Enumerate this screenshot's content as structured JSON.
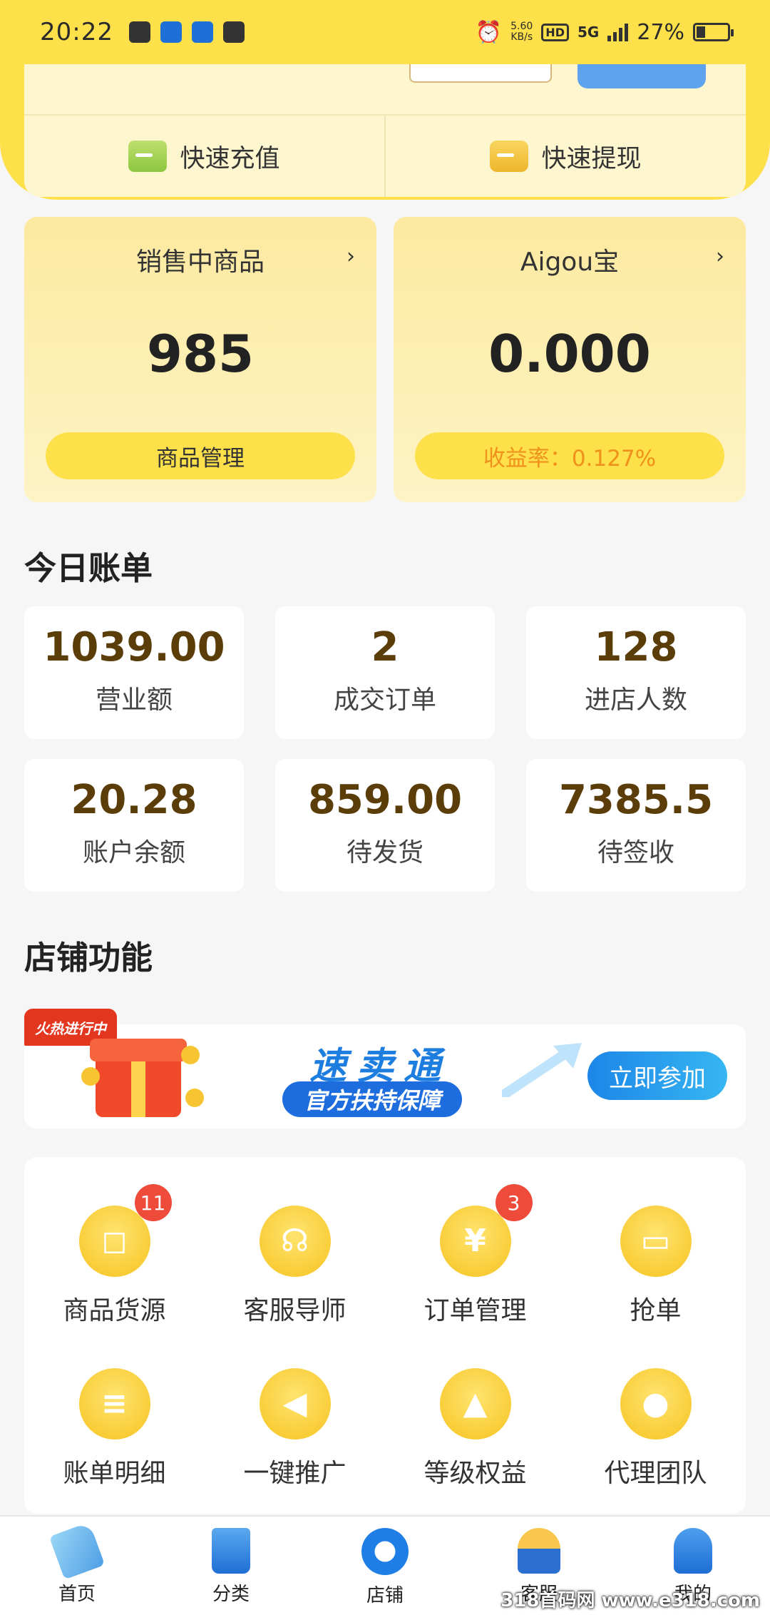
{
  "status_bar": {
    "time": "20:22",
    "net_speed": "5.60",
    "net_unit": "KB/s",
    "hd": "HD",
    "network": "5G",
    "battery": "27%"
  },
  "wallet": {
    "recharge_label": "快速充值",
    "withdraw_label": "快速提现"
  },
  "cards": [
    {
      "title": "销售中商品",
      "value": "985",
      "button": "商品管理"
    },
    {
      "title": "Aigou宝",
      "value": "0.000",
      "button": "收益率：0.127%"
    }
  ],
  "today": {
    "heading": "今日账单",
    "tiles": [
      {
        "value": "1039.00",
        "label": "营业额"
      },
      {
        "value": "2",
        "label": "成交订单"
      },
      {
        "value": "128",
        "label": "进店人数"
      },
      {
        "value": "20.28",
        "label": "账户余额"
      },
      {
        "value": "859.00",
        "label": "待发货"
      },
      {
        "value": "7385.5",
        "label": "待签收"
      }
    ]
  },
  "shop": {
    "heading": "店铺功能"
  },
  "banner": {
    "hot_tag": "火热进行中",
    "title": "速卖通",
    "subtitle": "官方扶持保障",
    "cta": "立即参加"
  },
  "functions": [
    {
      "label": "商品货源",
      "icon": "shopping-bag-icon",
      "badge": "11"
    },
    {
      "label": "客服导师",
      "icon": "headset-icon"
    },
    {
      "label": "订单管理",
      "icon": "order-book-icon",
      "badge": "3"
    },
    {
      "label": "抢单",
      "icon": "chat-bubble-icon"
    },
    {
      "label": "账单明细",
      "icon": "bill-list-icon"
    },
    {
      "label": "一键推广",
      "icon": "megaphone-icon"
    },
    {
      "label": "等级权益",
      "icon": "pyramid-icon"
    },
    {
      "label": "代理团队",
      "icon": "team-icon"
    }
  ],
  "tabbar": [
    {
      "label": "首页",
      "icon": "home-tag-icon"
    },
    {
      "label": "分类",
      "icon": "shopping-bag-icon"
    },
    {
      "label": "店铺",
      "icon": "store-icon",
      "active": true
    },
    {
      "label": "客服",
      "icon": "agent-icon"
    },
    {
      "label": "我的",
      "icon": "profile-icon"
    }
  ],
  "watermark": "318首码网 www.e318.com",
  "colors": {
    "brand_yellow": "#fde04a",
    "badge_red": "#ef4b3b",
    "value_brown": "#5a3d08",
    "cta_blue": "#1d86e8"
  }
}
